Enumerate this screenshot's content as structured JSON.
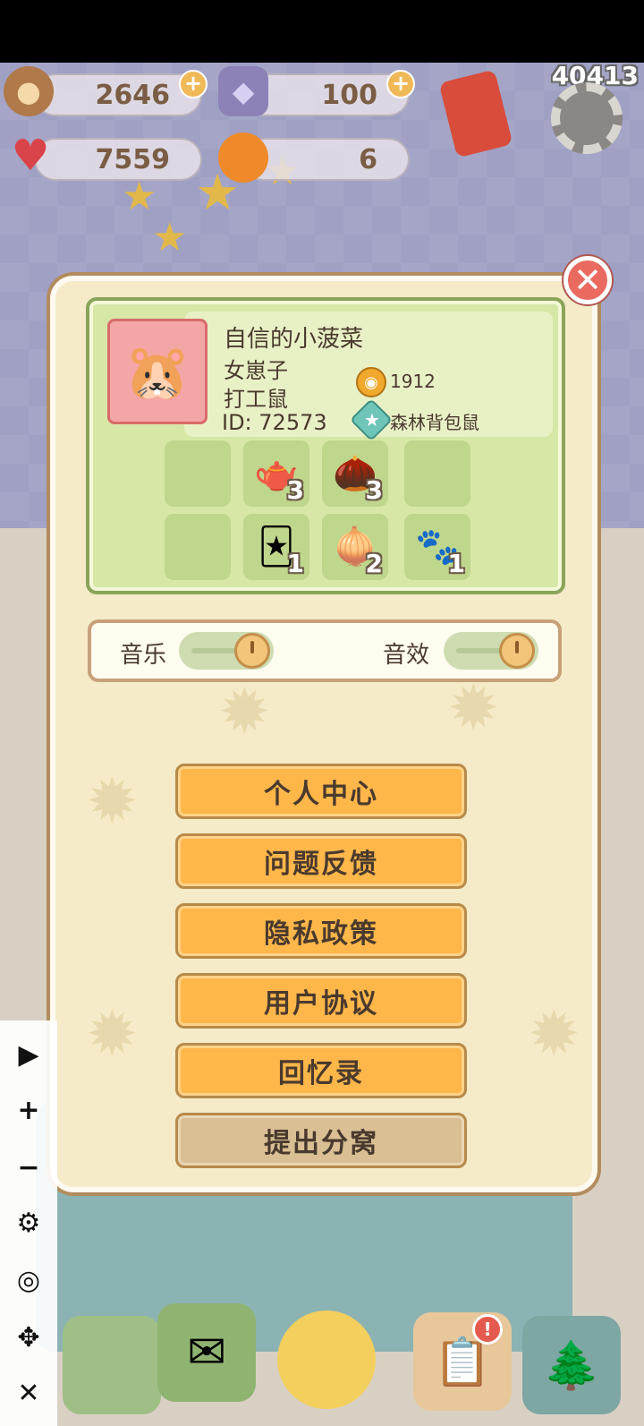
{
  "status": {
    "counter": "40413"
  },
  "resources": {
    "acorns": {
      "value": "2646",
      "icon": "acorn-icon"
    },
    "gems": {
      "value": "100",
      "icon": "crystal-icon"
    },
    "hearts": {
      "value": "7559",
      "icon": "heart-icon"
    },
    "oranges": {
      "value": "6",
      "icon": "orange-icon"
    }
  },
  "profile": {
    "name": "自信的小菠菜",
    "gender": "女崽子",
    "role": "打工鼠",
    "id_text": "ID: 72573",
    "bells": "1912",
    "badge": "森林背包鼠",
    "inventory": [
      {
        "icon": "empty-slot",
        "count": ""
      },
      {
        "icon": "teapot-icon",
        "count": "3"
      },
      {
        "icon": "acorn-icon",
        "count": "3"
      },
      {
        "icon": "empty-slot",
        "count": ""
      },
      {
        "icon": "empty-slot",
        "count": ""
      },
      {
        "icon": "cards-icon",
        "count": "1"
      },
      {
        "icon": "onion-icon",
        "count": "2"
      },
      {
        "icon": "paw-icon",
        "count": "1"
      }
    ]
  },
  "settings": {
    "music_label": "音乐",
    "sfx_label": "音效"
  },
  "menu": {
    "personal_center": "个人中心",
    "feedback": "问题反馈",
    "privacy_policy": "隐私政策",
    "user_agreement": "用户协议",
    "memories": "回忆录",
    "leave_nest": "提出分窝"
  },
  "colors": {
    "button_orange": "#ffb74a",
    "button_muted": "#d9bf93",
    "panel_bg": "#f5ebc9",
    "card_green": "#d6e7a6",
    "close_red": "#ea6a60"
  }
}
